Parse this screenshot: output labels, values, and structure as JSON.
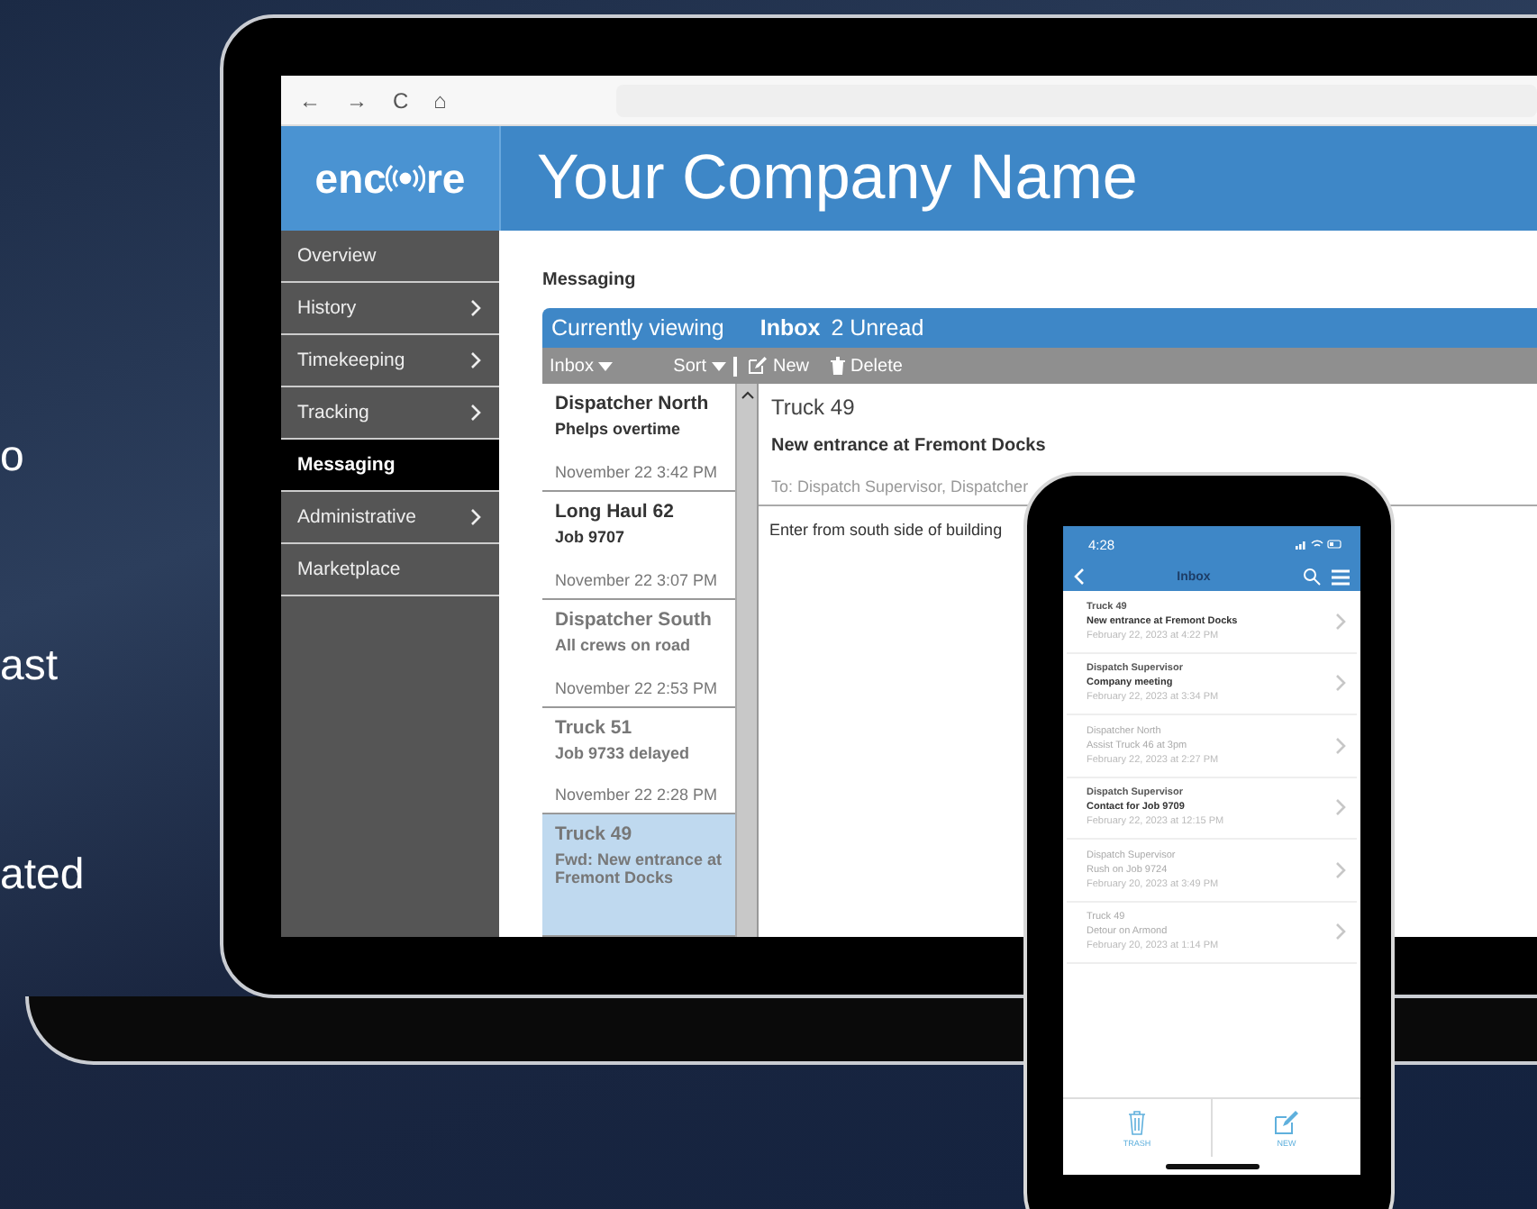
{
  "side_text": [
    "o",
    "ast",
    "ated"
  ],
  "browser": {
    "nav": [
      "←",
      "→",
      "C",
      "⌂"
    ]
  },
  "logo": {
    "left": "enc",
    "right": "re"
  },
  "company_title": "Your Company Name",
  "sidebar": {
    "items": [
      {
        "label": "Overview",
        "expandable": false,
        "selected": false
      },
      {
        "label": "History",
        "expandable": true,
        "selected": false
      },
      {
        "label": "Timekeeping",
        "expandable": true,
        "selected": false
      },
      {
        "label": "Tracking",
        "expandable": true,
        "selected": false
      },
      {
        "label": "Messaging",
        "expandable": false,
        "selected": true
      },
      {
        "label": "Administrative",
        "expandable": true,
        "selected": false
      },
      {
        "label": "Marketplace",
        "expandable": false,
        "selected": false
      }
    ]
  },
  "page_heading": "Messaging",
  "viewing_bar": {
    "label": "Currently viewing",
    "folder": "Inbox",
    "count": "2 Unread"
  },
  "toolbar": {
    "folder_menu": "Inbox",
    "sort_menu": "Sort",
    "new": "New",
    "delete": "Delete"
  },
  "messages": [
    {
      "sender": "Dispatcher North",
      "subject": "Phelps overtime",
      "date": "November 22 3:42 PM",
      "unread": true,
      "selected": false
    },
    {
      "sender": "Long Haul 62",
      "subject": "Job 9707",
      "date": "November 22 3:07 PM",
      "unread": true,
      "selected": false
    },
    {
      "sender": "Dispatcher South",
      "subject": "All crews on road",
      "date": "November 22 2:53 PM",
      "unread": false,
      "selected": false
    },
    {
      "sender": "Truck 51",
      "subject": "Job 9733 delayed",
      "date": "November 22 2:28 PM",
      "unread": false,
      "selected": false
    },
    {
      "sender": "Truck 49",
      "subject": "Fwd: New entrance at Fremont Docks",
      "unread": false,
      "selected": true
    }
  ],
  "detail": {
    "from": "Truck 49",
    "subject": "New entrance at Fremont Docks",
    "to": "To: Dispatch Supervisor, Dispatcher",
    "body": "Enter from south side of building"
  },
  "phone": {
    "time": "4:28",
    "title": "Inbox",
    "messages": [
      {
        "sender": "Truck 49",
        "subject": "New entrance at Fremont Docks",
        "date": "February 22, 2023 at 4:22 PM",
        "unread": true
      },
      {
        "sender": "Dispatch Supervisor",
        "subject": "Company meeting",
        "date": "February 22, 2023 at 3:34 PM",
        "unread": true
      },
      {
        "sender": "Dispatcher North",
        "subject": "Assist Truck 46 at 3pm",
        "date": "February 22, 2023 at 2:27 PM",
        "unread": false
      },
      {
        "sender": "Dispatch Supervisor",
        "subject": "Contact for Job 9709",
        "date": "February 22, 2023 at 12:15 PM",
        "unread": true
      },
      {
        "sender": "Dispatch Supervisor",
        "subject": "Rush on Job 9724",
        "date": "February 20, 2023 at 3:49 PM",
        "unread": false
      },
      {
        "sender": "Truck 49",
        "subject": "Detour on Armond",
        "date": "February 20, 2023 at 1:14 PM",
        "unread": false
      }
    ],
    "tabs": [
      {
        "kind": "trash",
        "label": "TRASH"
      },
      {
        "kind": "new",
        "label": "NEW"
      }
    ]
  }
}
